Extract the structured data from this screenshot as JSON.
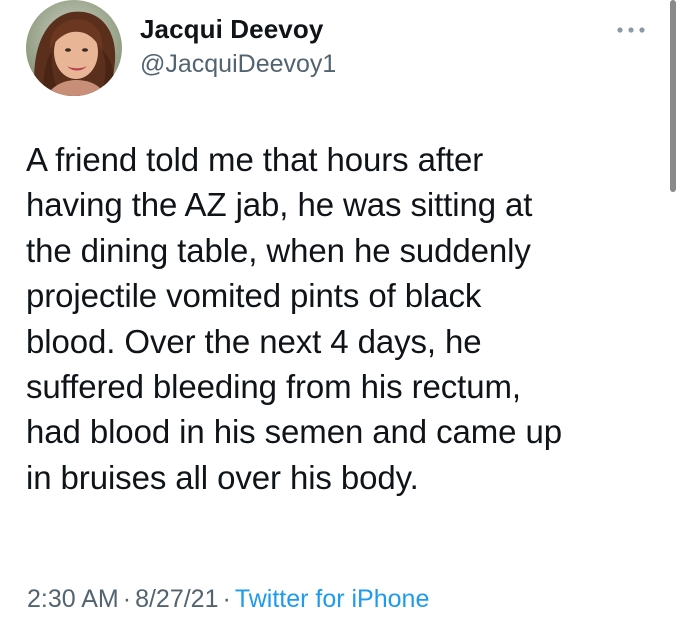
{
  "author": {
    "display_name": "Jacqui Deevoy",
    "handle": "@JacquiDeevoy1"
  },
  "tweet": {
    "text": "A friend told me that hours after\nhaving the AZ jab, he was sitting at\nthe dining table, when he suddenly\nprojectile vomited pints of black\nblood. Over the next 4 days, he\nsuffered bleeding from his rectum,\nhad blood in his semen and came up\nin bruises all over his body."
  },
  "meta": {
    "time": "2:30 AM",
    "separator": "·",
    "date": "8/27/21",
    "source": "Twitter for iPhone"
  },
  "icons": {
    "more": "more-options-icon",
    "avatar": "profile-avatar"
  },
  "colors": {
    "text": "#0f1419",
    "secondary": "#536471",
    "link": "#1d9bf0"
  }
}
